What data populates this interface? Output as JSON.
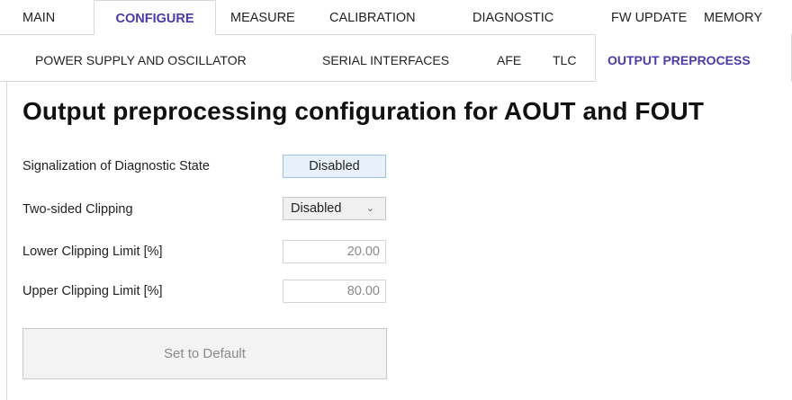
{
  "top_tabs": [
    "MAIN",
    "CONFIGURE",
    "MEASURE",
    "CALIBRATION",
    "DIAGNOSTIC",
    "FW UPDATE",
    "MEMORY"
  ],
  "active_top_tab": "CONFIGURE",
  "sub_tabs": [
    "POWER SUPPLY AND OSCILLATOR",
    "SERIAL INTERFACES",
    "AFE",
    "TLC",
    "OUTPUT PREPROCESS"
  ],
  "active_sub_tab": "OUTPUT PREPROCESS",
  "heading": "Output preprocessing configuration for AOUT and FOUT",
  "rows": {
    "signalization": {
      "label": "Signalization of Diagnostic State",
      "value": "Disabled"
    },
    "two_sided": {
      "label": "Two-sided Clipping",
      "value": "Disabled"
    },
    "lower": {
      "label": "Lower Clipping Limit [%]",
      "value": "20.00"
    },
    "upper": {
      "label": "Upper Clipping Limit [%]",
      "value": "80.00"
    }
  },
  "default_button": "Set to Default",
  "colors": {
    "accent": "#4a3aa6",
    "badge_bg": "#e8f1fb",
    "badge_border": "#9dc3e6",
    "disabled_text": "#8a8a8a"
  },
  "icons": {
    "dropdown": "chevron-down-icon"
  }
}
